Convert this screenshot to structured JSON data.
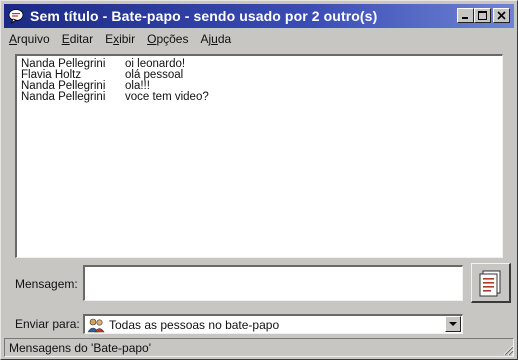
{
  "window": {
    "title": "Sem título - Bate-papo - sendo usado por 2 outro(s)",
    "controls": {
      "minimize": "_",
      "maximize": "□",
      "close": "✕"
    }
  },
  "menu": [
    {
      "u": "A",
      "rest": "rquivo"
    },
    {
      "u": "E",
      "rest": "ditar"
    },
    {
      "pre": "E",
      "u": "x",
      "rest": "ibir"
    },
    {
      "u": "O",
      "rest": "pções"
    },
    {
      "pre": "Aj",
      "u": "u",
      "rest": "da"
    }
  ],
  "messages": [
    {
      "sender": "Nanda Pellegrini",
      "text": "oi leonardo!"
    },
    {
      "sender": "Flavia Holtz",
      "text": "olá pessoal"
    },
    {
      "sender": "Nanda Pellegrini",
      "text": "ola!!!"
    },
    {
      "sender": "Nanda Pellegrini",
      "text": "voce tem video?"
    }
  ],
  "compose": {
    "label": "Mensagem:",
    "value": ""
  },
  "send_to": {
    "label": "Enviar para:",
    "selected": "Todas as pessoas no bate-papo"
  },
  "status": "Mensagens do 'Bate-papo'",
  "icons": {
    "title": "chat-bubble-icon",
    "send": "send-document-icon",
    "recipients": "people-icon",
    "dropdown": "chevron-down-icon"
  }
}
